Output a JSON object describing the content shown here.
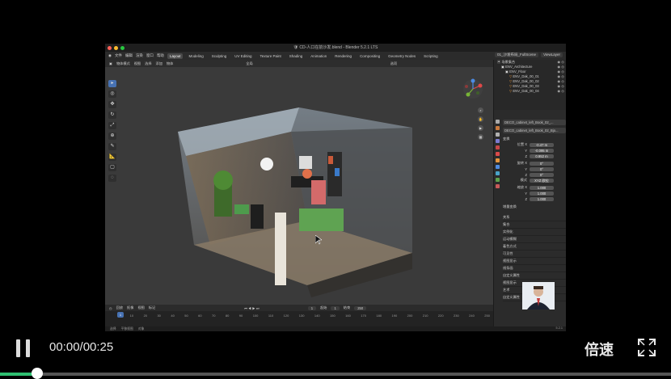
{
  "window": {
    "title": "🛡 CD-人口在前沙发.blend - Blender 5.2.1 LTS",
    "traffic_colors": [
      "#ff5f57",
      "#febc2e",
      "#28c840"
    ]
  },
  "menubar": {
    "items": [
      "文件",
      "编辑",
      "渲染",
      "窗口",
      "帮助"
    ],
    "workspaces": [
      "Layout",
      "Modeling",
      "Sculpting",
      "UV Editing",
      "Texture Paint",
      "Shading",
      "Animation",
      "Rendering",
      "Compositing",
      "Geometry Nodes",
      "Scripting"
    ],
    "active_workspace": "Layout",
    "scene": "01_沙发布局_FullScene",
    "view_layer": "ViewLayer"
  },
  "viewport_header": {
    "mode": "物体模式",
    "items": [
      "视图",
      "选择",
      "添加",
      "物体"
    ],
    "transform": "全局",
    "options": "选项"
  },
  "outliner": {
    "rows": [
      {
        "label": "场景集合",
        "indent": 0
      },
      {
        "label": "ENV_Architecture",
        "indent": 1
      },
      {
        "label": "ENV_Floor",
        "indent": 2
      },
      {
        "label": "ENV_Dak_00_01",
        "indent": 3
      },
      {
        "label": "ENV_Dak_00_02",
        "indent": 3
      },
      {
        "label": "ENV_Dak_00_03",
        "indent": 3
      },
      {
        "label": "ENV_Dak_00_04",
        "indent": 3
      }
    ]
  },
  "properties": {
    "object_name": "DECO_cabinet_left_Book_02_...",
    "object_sub": "DECO_cabinet_left_Book_02_Bjo...",
    "section_transform": "变换",
    "location_label": "位置 X",
    "location": [
      "-0.47 m",
      "-0.095 m",
      "0.952 m"
    ],
    "rotation_label": "旋转 X",
    "rotation": [
      "0°",
      "0°",
      "0°"
    ],
    "mode_label": "模式",
    "mode_value": "XYZ 欧拉",
    "scale_label": "缩放 X",
    "scale": [
      "1.000",
      "1.000",
      "1.000"
    ],
    "axis_y": "Y",
    "axis_z": "Z",
    "delta": "增量变换",
    "relations": "关系",
    "panels": [
      "关系",
      "集合",
      "实例化",
      "运动模糊",
      "着色方式",
      "可见性",
      "视图显示",
      "线条画",
      "自定义属性",
      "视图显示",
      "艺术",
      "自定义属性"
    ]
  },
  "timeline": {
    "items": [
      "回放",
      "抠像",
      "视图",
      "标记"
    ],
    "current_frame": "1",
    "start_label": "起始",
    "start": "1",
    "end_label": "结束",
    "end": "250",
    "ticks": [
      "1",
      "10",
      "20",
      "30",
      "40",
      "50",
      "60",
      "70",
      "80",
      "90",
      "100",
      "110",
      "120",
      "130",
      "140",
      "150",
      "160",
      "170",
      "180",
      "190",
      "200",
      "210",
      "220",
      "230",
      "240",
      "250"
    ]
  },
  "statusbar": {
    "items": [
      "选择",
      "平移视图",
      "对象"
    ],
    "version": "5.2.1"
  },
  "player": {
    "time": "00:00/00:25",
    "speed_label": "倍速",
    "progress": 0.055,
    "accent": "#2fbf71"
  }
}
